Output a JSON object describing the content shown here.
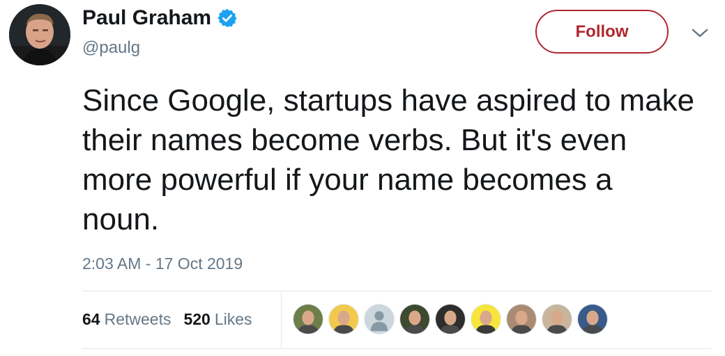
{
  "author": {
    "name": "Paul Graham",
    "handle": "@paulg",
    "avatar_icon": "profile-photo",
    "verified_icon": "verified-badge-icon",
    "verified_color": "#1da1f2"
  },
  "follow": {
    "label": "Follow",
    "color": "#b0272f"
  },
  "menu": {
    "icon": "chevron-down-icon"
  },
  "tweet": {
    "text": "Since Google, startups have aspired to make their names become verbs. But it's even more powerful if your name becomes a noun.",
    "timestamp": "2:03 AM - 17 Oct 2019"
  },
  "stats": {
    "retweets_count": "64",
    "retweets_label": "Retweets",
    "likes_count": "520",
    "likes_label": "Likes"
  },
  "likers": [
    {
      "icon": "liker-avatar-1",
      "bg": "#6d7e4a"
    },
    {
      "icon": "liker-avatar-2",
      "bg": "#f2c94c"
    },
    {
      "icon": "liker-avatar-3",
      "bg": "#ccd6dd"
    },
    {
      "icon": "liker-avatar-4",
      "bg": "#3e4a2f"
    },
    {
      "icon": "liker-avatar-5",
      "bg": "#2d2d2d"
    },
    {
      "icon": "liker-avatar-6",
      "bg": "#f7e53b"
    },
    {
      "icon": "liker-avatar-7",
      "bg": "#a98b73"
    },
    {
      "icon": "liker-avatar-8",
      "bg": "#c9b59b"
    },
    {
      "icon": "liker-avatar-9",
      "bg": "#3a5a8a"
    }
  ]
}
